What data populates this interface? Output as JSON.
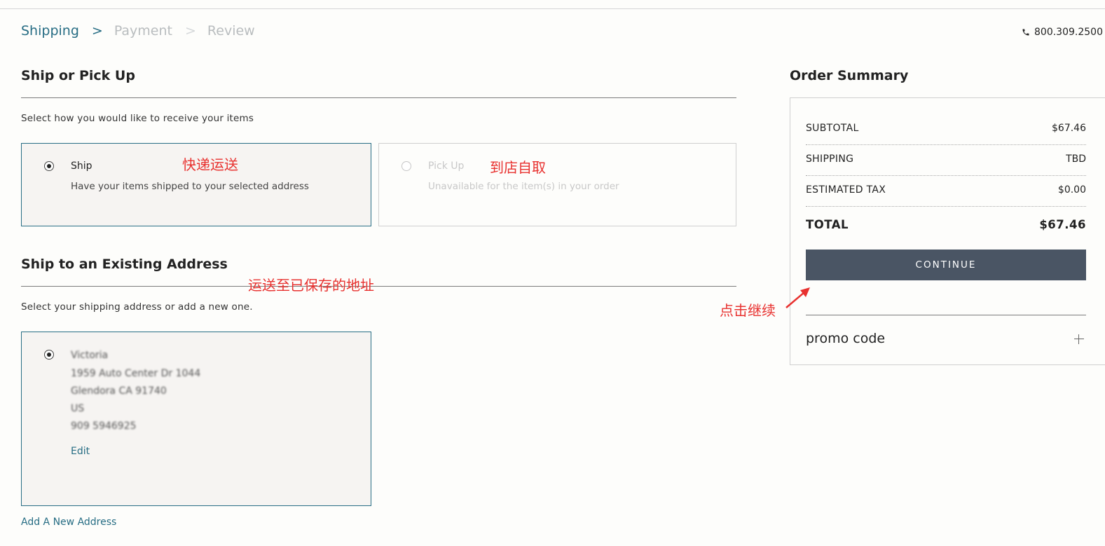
{
  "breadcrumb": {
    "steps": [
      "Shipping",
      "Payment",
      "Review"
    ],
    "separator": ">"
  },
  "phone": {
    "icon": "phone-icon",
    "number": "800.309.2500"
  },
  "ship_section": {
    "title": "Ship or Pick Up",
    "helper": "Select how you would like to receive your items",
    "options": [
      {
        "title": "Ship",
        "desc": "Have your items shipped to your selected address",
        "selected": true
      },
      {
        "title": "Pick Up",
        "desc": "Unavailable for the item(s) in your order",
        "selected": false
      }
    ]
  },
  "address_section": {
    "title": "Ship to an Existing Address",
    "helper": "Select your shipping address or add a new one.",
    "address_lines": [
      "Victoria",
      "1959 Auto Center Dr 1044",
      "Glendora CA 91740",
      "US",
      "909 5946925"
    ],
    "edit_label": "Edit",
    "add_label": "Add A New Address"
  },
  "summary": {
    "title": "Order Summary",
    "rows": [
      {
        "label": "SUBTOTAL",
        "value": "$67.46"
      },
      {
        "label": "SHIPPING",
        "value": "TBD"
      },
      {
        "label": "ESTIMATED TAX",
        "value": "$0.00"
      }
    ],
    "total_label": "TOTAL",
    "total_value": "$67.46",
    "continue_label": "CONTINUE",
    "promo_label": "promo code"
  },
  "annotations": {
    "ship": "快递运送",
    "pickup": "到店自取",
    "address": "运送至已保存的地址",
    "continue": "点击继续",
    "color": "#e8312f"
  },
  "colors": {
    "accent": "#276d84",
    "button": "#4a5564",
    "background": "#fdfdfb"
  }
}
